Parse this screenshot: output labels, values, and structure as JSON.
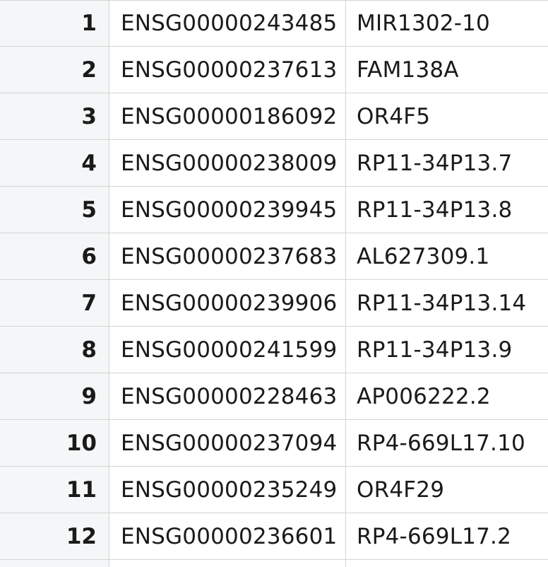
{
  "table": {
    "rows": [
      {
        "index": "1",
        "gene_id": "ENSG00000243485",
        "gene_name": "MIR1302-10"
      },
      {
        "index": "2",
        "gene_id": "ENSG00000237613",
        "gene_name": "FAM138A"
      },
      {
        "index": "3",
        "gene_id": "ENSG00000186092",
        "gene_name": "OR4F5"
      },
      {
        "index": "4",
        "gene_id": "ENSG00000238009",
        "gene_name": "RP11-34P13.7"
      },
      {
        "index": "5",
        "gene_id": "ENSG00000239945",
        "gene_name": "RP11-34P13.8"
      },
      {
        "index": "6",
        "gene_id": "ENSG00000237683",
        "gene_name": "AL627309.1"
      },
      {
        "index": "7",
        "gene_id": "ENSG00000239906",
        "gene_name": "RP11-34P13.14"
      },
      {
        "index": "8",
        "gene_id": "ENSG00000241599",
        "gene_name": "RP11-34P13.9"
      },
      {
        "index": "9",
        "gene_id": "ENSG00000228463",
        "gene_name": "AP006222.2"
      },
      {
        "index": "10",
        "gene_id": "ENSG00000237094",
        "gene_name": "RP4-669L17.10"
      },
      {
        "index": "11",
        "gene_id": "ENSG00000235249",
        "gene_name": "OR4F29"
      },
      {
        "index": "12",
        "gene_id": "ENSG00000236601",
        "gene_name": "RP4-669L17.2"
      }
    ]
  },
  "colors": {
    "index_column_bg": "#f4f6f7",
    "grid_line": "#d4d4d4",
    "text": "#1a1a1a"
  }
}
